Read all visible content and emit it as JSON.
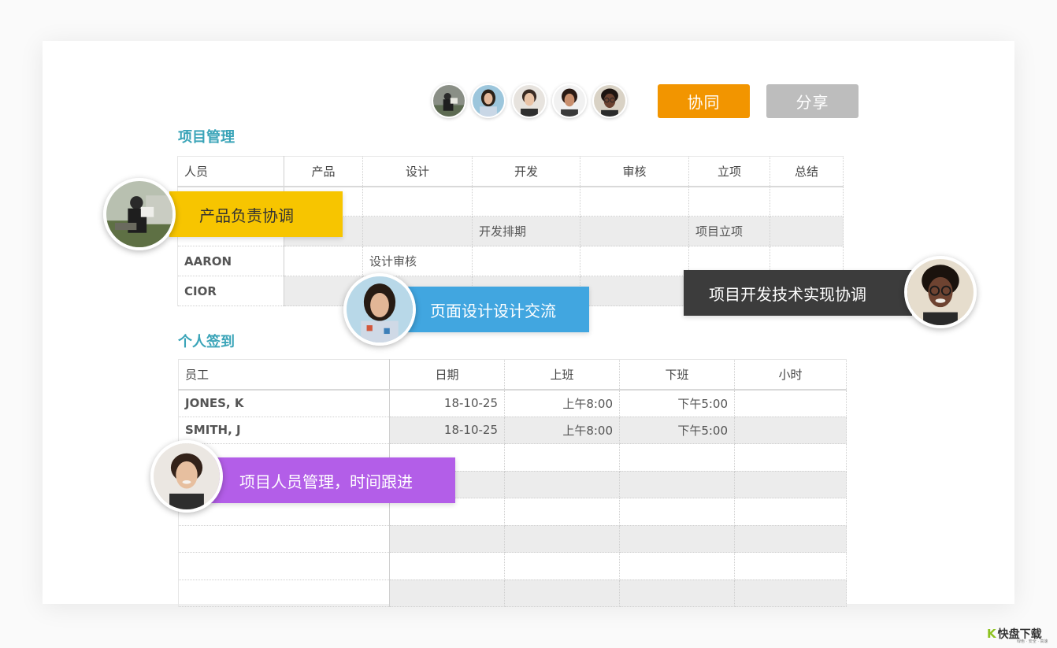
{
  "toolbar": {
    "collab_label": "协同",
    "share_label": "分享",
    "colors": {
      "collab": "#f29500",
      "share": "#bdbdbd"
    }
  },
  "project": {
    "title": "项目管理",
    "columns": [
      "人员",
      "产品",
      "设计",
      "开发",
      "审核",
      "立项",
      "总结"
    ],
    "rows": [
      [
        "",
        "",
        "",
        "",
        "",
        "",
        ""
      ],
      [
        "",
        "",
        "",
        "开发排期",
        "",
        "项目立项",
        ""
      ],
      [
        "AARON",
        "",
        "设计审核",
        "",
        "",
        "",
        ""
      ],
      [
        "CIOR",
        "",
        "",
        "",
        "",
        "",
        ""
      ]
    ]
  },
  "signin": {
    "title": "个人签到",
    "columns": [
      "员工",
      "日期",
      "上班",
      "下班",
      "小时"
    ],
    "rows": [
      [
        "JONES, K",
        "18-10-25",
        "上午8:00",
        "下午5:00",
        ""
      ],
      [
        "SMITH, J",
        "18-10-25",
        "上午8:00",
        "下午5:00",
        ""
      ],
      [
        "",
        "",
        "",
        "",
        ""
      ],
      [
        "",
        "",
        "",
        "",
        ""
      ],
      [
        "",
        "",
        "",
        "",
        ""
      ],
      [
        "",
        "",
        "",
        "",
        ""
      ],
      [
        "",
        "",
        "",
        "",
        ""
      ],
      [
        "",
        "",
        "",
        "",
        ""
      ]
    ]
  },
  "callouts": [
    {
      "text": "产品负责协调",
      "color": "#f7c500"
    },
    {
      "text": "页面设计设计交流",
      "color": "#41a6e0"
    },
    {
      "text": "项目开发技术实现协调",
      "color": "#3c3c3c"
    },
    {
      "text": "项目人员管理，时间跟进",
      "color": "#b35ee8"
    }
  ],
  "brand": {
    "name": "快盘下载",
    "logo_letter": "K",
    "tagline": "绿色 · 安全 · 高速"
  }
}
